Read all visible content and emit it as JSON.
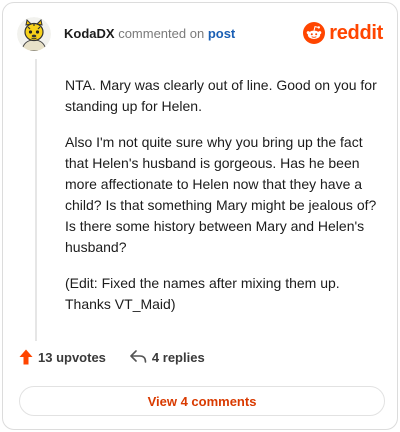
{
  "comment": {
    "username": "KodaDX",
    "action_text": "commented on",
    "post_link": "post",
    "paragraphs": [
      "NTA. Mary was clearly out of line. Good on you for standing up for Helen.",
      "Also I'm not quite sure why you bring up the fact that Helen's husband is gorgeous. Has he been more affectionate to Helen now that they have a child? Is that something Mary might be jealous of? Is there some history between Mary and Helen's husband?",
      "(Edit: Fixed the names after mixing them up. Thanks VT_Maid)"
    ]
  },
  "brand": {
    "wordmark": "reddit",
    "color": "#ff4500"
  },
  "actions": {
    "upvotes": "13 upvotes",
    "replies": "4 replies",
    "upvote_icon": "upvote-arrow-icon",
    "reply_icon": "reply-arrow-icon"
  },
  "footer": {
    "view_comments": "View 4 comments",
    "accent": "#d93a00"
  }
}
